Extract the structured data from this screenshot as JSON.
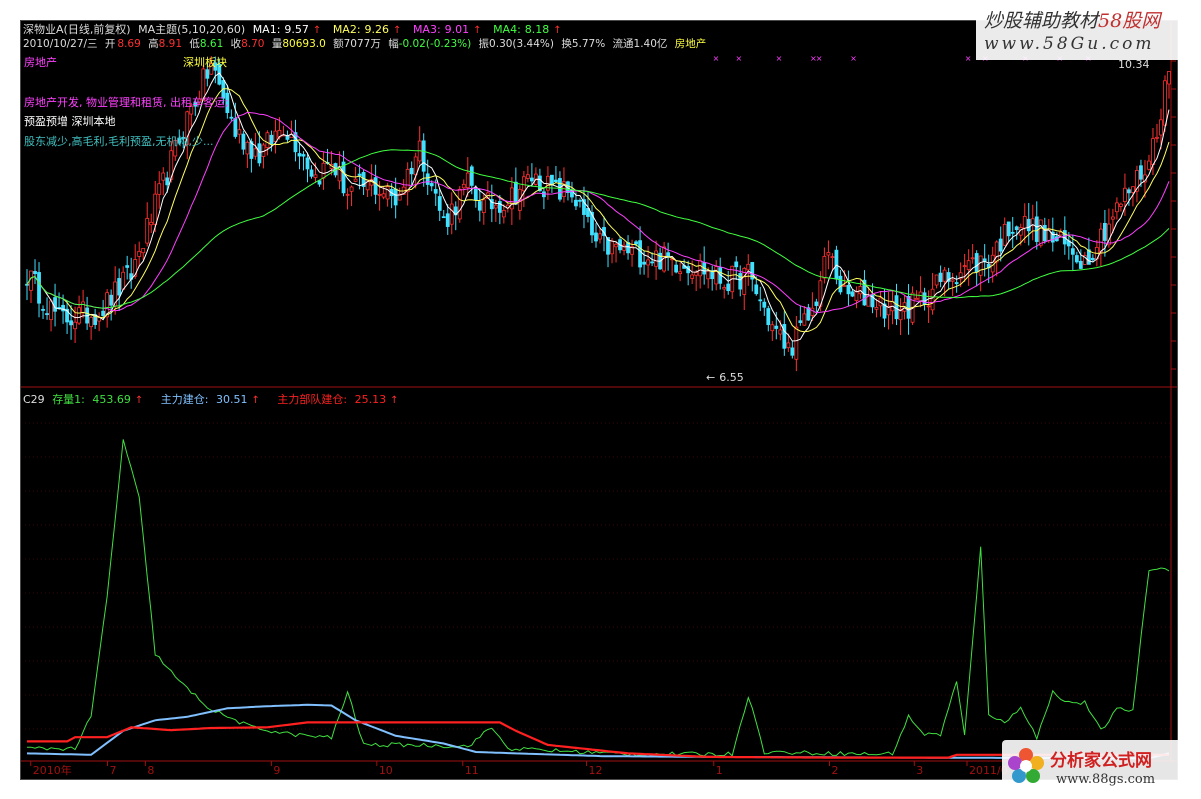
{
  "header": {
    "title": "深物业A(日线,前复权)",
    "theme_label": "MA主题(5,10,20,60)",
    "ma1_label": "MA1:",
    "ma1": "9.57",
    "ma2_label": "MA2:",
    "ma2": "9.26",
    "ma3_label": "MA3:",
    "ma3": "9.01",
    "ma4_label": "MA4:",
    "ma4": "8.18",
    "date": "2010/10/27/三",
    "open_label": "开",
    "open": "8.69",
    "high_label": "高",
    "high": "8.91",
    "low_label": "低",
    "low": "8.61",
    "close_label": "收",
    "close": "8.70",
    "volume_label": "量",
    "volume": "80693.0",
    "amount_label": "额",
    "amount": "7077万",
    "change_label": "幅",
    "change": "-0.02(-0.23%)",
    "amplitude_label": "振",
    "amplitude": "0.30(3.44%)",
    "turnover_label": "换",
    "turnover": "5.77%",
    "float_label": "流通",
    "float": "1.40亿",
    "industry": "房地产"
  },
  "info": {
    "sector": "房地产",
    "board": "深圳板块",
    "business": "房地产开发, 物业管理和租赁, 出租车客运;",
    "forecast": "预盈预增 深圳本地",
    "notes": "股东减少,高毛利,毛利预盈,无机构,少..."
  },
  "sub_header": {
    "name": "C29",
    "s1_label": "存量1:",
    "s1": "453.69",
    "s2_label": "主力建仓:",
    "s2": "30.51",
    "s3_label": "主力部队建仓:",
    "s3": "25.13"
  },
  "annotations": {
    "price_high": "10.34",
    "price_low": "6.55"
  },
  "x_axis": {
    "labels": [
      {
        "text": "2010年",
        "pos": 0.005
      },
      {
        "text": "7",
        "pos": 0.072
      },
      {
        "text": "8",
        "pos": 0.105
      },
      {
        "text": "9",
        "pos": 0.215
      },
      {
        "text": "10",
        "pos": 0.307
      },
      {
        "text": "11",
        "pos": 0.382
      },
      {
        "text": "12",
        "pos": 0.49
      },
      {
        "text": "1",
        "pos": 0.601
      },
      {
        "text": "2",
        "pos": 0.702
      },
      {
        "text": "3",
        "pos": 0.776
      },
      {
        "text": "2011/0",
        "pos": 0.822
      }
    ]
  },
  "watermarks": {
    "top_cn": "炒股辅助教材",
    "top_brand": "58股网",
    "top_url": "www.58Gu.com",
    "bottom_cn": "分析家公式网",
    "bottom_url": "www.88gs.com"
  },
  "colors": {
    "up": "#ff3030",
    "down": "#40e0ff",
    "ma1": "#ffffff",
    "ma2": "#ffff60",
    "ma3": "#ff40ff",
    "ma4": "#40ff40",
    "s1": "#40e040",
    "s2": "#80c0ff",
    "s3": "#ff2020",
    "axis": "#a01010",
    "text_white": "#dddddd",
    "text_yellow": "#ffff40",
    "text_magenta": "#ff40ff",
    "text_cyan": "#40e0e0",
    "text_green": "#40ff40"
  },
  "chart_data": {
    "type": "line",
    "price_ylim": [
      6.2,
      10.5
    ],
    "price_keys": [
      [
        0,
        7.6
      ],
      [
        8,
        7.0
      ],
      [
        18,
        7.1
      ],
      [
        26,
        7.6
      ],
      [
        34,
        8.8
      ],
      [
        40,
        9.7
      ],
      [
        46,
        10.4
      ],
      [
        52,
        9.5
      ],
      [
        58,
        9.2
      ],
      [
        64,
        9.6
      ],
      [
        68,
        9.3
      ],
      [
        72,
        8.9
      ],
      [
        76,
        9.1
      ],
      [
        80,
        8.7
      ],
      [
        86,
        8.8
      ],
      [
        92,
        8.6
      ],
      [
        98,
        9.3
      ],
      [
        104,
        8.3
      ],
      [
        110,
        8.8
      ],
      [
        114,
        8.5
      ],
      [
        120,
        8.6
      ],
      [
        126,
        8.9
      ],
      [
        132,
        8.7
      ],
      [
        136,
        8.7
      ],
      [
        142,
        8.0
      ],
      [
        150,
        7.9
      ],
      [
        160,
        7.8
      ],
      [
        168,
        7.7
      ],
      [
        174,
        7.5
      ],
      [
        180,
        7.6
      ],
      [
        186,
        6.9
      ],
      [
        190,
        6.6
      ],
      [
        196,
        7.1
      ],
      [
        200,
        7.9
      ],
      [
        204,
        7.3
      ],
      [
        210,
        7.3
      ],
      [
        216,
        7.1
      ],
      [
        222,
        7.2
      ],
      [
        228,
        7.5
      ],
      [
        234,
        7.7
      ],
      [
        240,
        7.8
      ],
      [
        246,
        8.3
      ],
      [
        252,
        8.2
      ],
      [
        258,
        8.0
      ],
      [
        264,
        7.8
      ],
      [
        270,
        8.3
      ],
      [
        276,
        8.8
      ],
      [
        280,
        9.1
      ],
      [
        285,
        10.3
      ]
    ],
    "volume_ylim": [
      0,
      500
    ],
    "series": [
      {
        "name": "存量1",
        "key_points": [
          [
            0,
            15
          ],
          [
            12,
            15
          ],
          [
            16,
            60
          ],
          [
            20,
            230
          ],
          [
            24,
            453
          ],
          [
            28,
            370
          ],
          [
            32,
            150
          ],
          [
            38,
            110
          ],
          [
            46,
            70
          ],
          [
            56,
            45
          ],
          [
            66,
            35
          ],
          [
            76,
            30
          ],
          [
            80,
            95
          ],
          [
            84,
            20
          ],
          [
            96,
            20
          ],
          [
            110,
            18
          ],
          [
            116,
            45
          ],
          [
            120,
            15
          ],
          [
            150,
            7
          ],
          [
            176,
            7
          ],
          [
            180,
            90
          ],
          [
            184,
            10
          ],
          [
            210,
            7
          ],
          [
            214,
            7
          ],
          [
            216,
            8
          ],
          [
            220,
            60
          ],
          [
            224,
            35
          ],
          [
            228,
            35
          ],
          [
            232,
            110
          ],
          [
            234,
            33
          ],
          [
            238,
            300
          ],
          [
            240,
            65
          ],
          [
            244,
            50
          ],
          [
            248,
            75
          ],
          [
            252,
            30
          ],
          [
            256,
            95
          ],
          [
            260,
            80
          ],
          [
            264,
            80
          ],
          [
            268,
            40
          ],
          [
            272,
            70
          ],
          [
            276,
            70
          ],
          [
            280,
            270
          ]
        ]
      },
      {
        "name": "主力建仓",
        "key_points": [
          [
            0,
            8
          ],
          [
            16,
            6
          ],
          [
            24,
            40
          ],
          [
            32,
            55
          ],
          [
            40,
            60
          ],
          [
            50,
            72
          ],
          [
            60,
            75
          ],
          [
            70,
            77
          ],
          [
            76,
            76
          ],
          [
            82,
            55
          ],
          [
            92,
            33
          ],
          [
            104,
            22
          ],
          [
            112,
            10
          ],
          [
            122,
            8
          ],
          [
            144,
            4
          ],
          [
            170,
            3
          ],
          [
            220,
            2
          ],
          [
            280,
            1
          ],
          [
            285,
            8
          ]
        ]
      },
      {
        "name": "主力部队建仓",
        "key_points": [
          [
            0,
            25
          ],
          [
            10,
            25
          ],
          [
            12,
            31
          ],
          [
            20,
            31
          ],
          [
            26,
            45
          ],
          [
            36,
            41
          ],
          [
            46,
            44
          ],
          [
            60,
            45
          ],
          [
            70,
            52
          ],
          [
            90,
            52
          ],
          [
            110,
            52
          ],
          [
            118,
            52
          ],
          [
            122,
            40
          ],
          [
            130,
            20
          ],
          [
            150,
            8
          ],
          [
            170,
            3
          ],
          [
            200,
            2
          ],
          [
            230,
            2
          ],
          [
            232,
            6
          ],
          [
            250,
            6
          ],
          [
            260,
            6
          ],
          [
            280,
            6
          ],
          [
            285,
            6
          ]
        ]
      }
    ]
  }
}
